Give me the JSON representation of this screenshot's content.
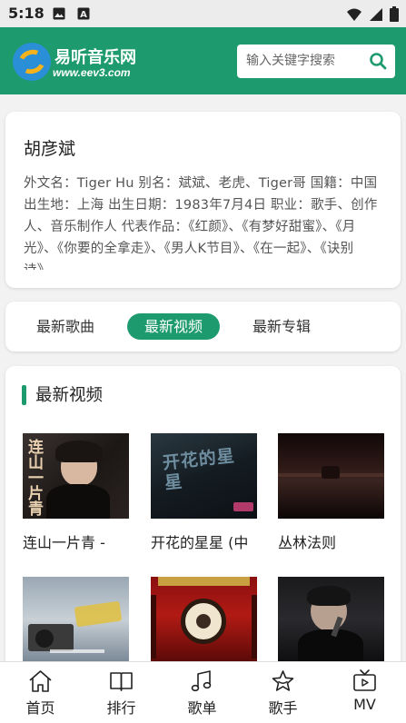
{
  "status_bar": {
    "time": "5:18"
  },
  "header": {
    "site_name": "易听音乐网",
    "site_url": "www.eev3.com",
    "search_placeholder": "输入关键字搜索"
  },
  "artist": {
    "name": "胡彦斌",
    "bio": "外文名：Tiger Hu 别名：斌斌、老虎、Tiger哥 国籍：中国 出生地：上海 出生日期：1983年7月4日 职业：歌手、创作人、音乐制作人 代表作品：《红颜》、《有梦好甜蜜》、《月光》、《你要的全拿走》、《男人K节目》、《在一起》、《诀别诗》、"
  },
  "tabs": [
    {
      "label": "最新歌曲",
      "active": false
    },
    {
      "label": "最新视频",
      "active": true
    },
    {
      "label": "最新专辑",
      "active": false
    }
  ],
  "videos_section": {
    "title": "最新视频",
    "videos": [
      {
        "title": "连山一片青 -",
        "thumb_overlay": "连山一片青"
      },
      {
        "title": "开花的星星 (中",
        "thumb_overlay": "开花的星星"
      },
      {
        "title": "丛林法则",
        "thumb_overlay": ""
      },
      {
        "title": "",
        "thumb_overlay": ""
      },
      {
        "title": "",
        "thumb_overlay": ""
      },
      {
        "title": "",
        "thumb_overlay": ""
      }
    ]
  },
  "bottom_nav": [
    {
      "label": "首页",
      "icon": "home-icon"
    },
    {
      "label": "排行",
      "icon": "book-icon"
    },
    {
      "label": "歌单",
      "icon": "music-note-icon"
    },
    {
      "label": "歌手",
      "icon": "star-icon"
    },
    {
      "label": "MV",
      "icon": "tv-icon"
    }
  ],
  "colors": {
    "accent": "#1e9b6e",
    "header_bg": "#1e9b6e",
    "page_bg": "#f2f2f2"
  }
}
